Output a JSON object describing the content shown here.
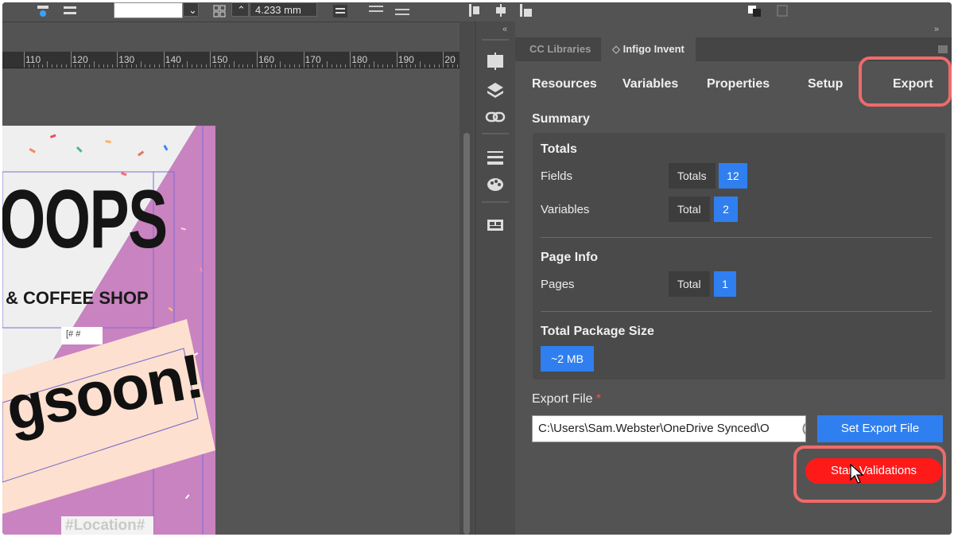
{
  "toolbar": {
    "measure_value": "4.233 mm"
  },
  "ruler": {
    "labels": [
      "110",
      "120",
      "130",
      "140",
      "150",
      "160",
      "170",
      "180",
      "190",
      "20"
    ]
  },
  "document": {
    "headline": "OOPS",
    "subtitle": "& COFFEE SHOP",
    "slogan": "gsoon!",
    "location_tag": "#Location#",
    "note_text": "[# #"
  },
  "panel": {
    "tabs": [
      {
        "label": "CC Libraries"
      },
      {
        "label": "◇ Infigo Invent"
      }
    ],
    "subnav": [
      {
        "label": "Resources"
      },
      {
        "label": "Variables"
      },
      {
        "label": "Properties"
      },
      {
        "label": "Setup"
      },
      {
        "label": "Export"
      }
    ],
    "summary_title": "Summary",
    "totals": {
      "title": "Totals",
      "fields_label": "Fields",
      "fields_key": "Totals",
      "fields_value": "12",
      "variables_label": "Variables",
      "variables_key": "Total",
      "variables_value": "2"
    },
    "page_info": {
      "title": "Page Info",
      "pages_label": "Pages",
      "pages_key": "Total",
      "pages_value": "1"
    },
    "package": {
      "title": "Total Package Size",
      "value": "~2 MB"
    },
    "export_file": {
      "label": "Export File",
      "required_mark": "*",
      "path": "C:\\Users\\Sam.Webster\\OneDrive Synced\\O",
      "set_button": "Set Export File",
      "start_button": "Start Validations"
    }
  },
  "colors": {
    "accent_blue": "#2f7ff0",
    "start_red": "#ff1a1a",
    "highlight": "#f06a6a",
    "pink_bg": "#c983c0"
  }
}
